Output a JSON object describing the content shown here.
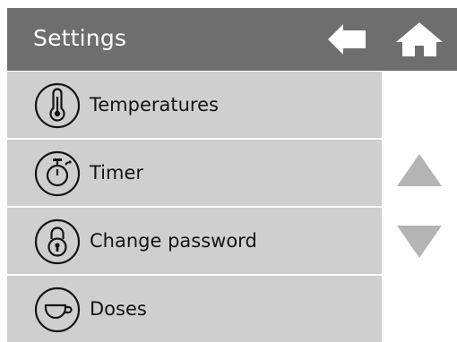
{
  "header": {
    "title": "Settings",
    "background_color": "#6e6e6e",
    "back_icon": "back-arrow-icon",
    "home_icon": "home-icon"
  },
  "menu": {
    "item_background_color": "#cfcfcf",
    "items": [
      {
        "label": "Temperatures",
        "icon": "thermometer-icon"
      },
      {
        "label": "Timer",
        "icon": "stopwatch-icon"
      },
      {
        "label": "Change password",
        "icon": "lock-icon"
      },
      {
        "label": "Doses",
        "icon": "cup-icon"
      }
    ]
  },
  "scroll": {
    "up_icon": "triangle-up-icon",
    "down_icon": "triangle-down-icon",
    "color": "#b4b4b4"
  }
}
